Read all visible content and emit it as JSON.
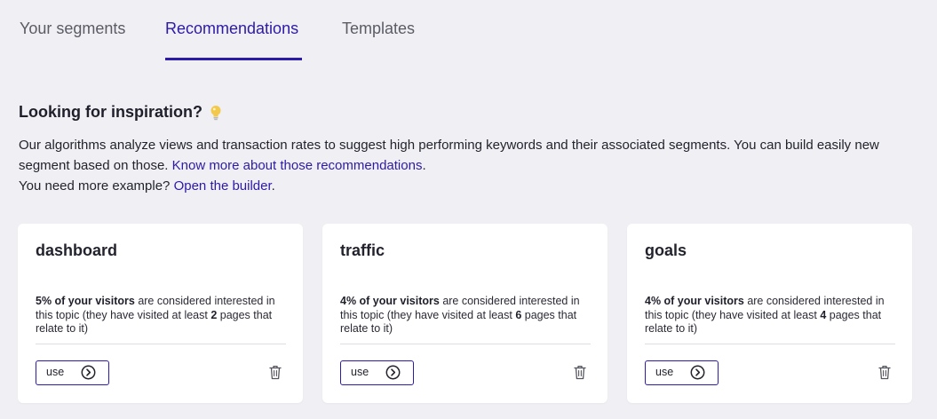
{
  "tabs": [
    {
      "label": "Your segments"
    },
    {
      "label": "Recommendations"
    },
    {
      "label": "Templates"
    }
  ],
  "intro": {
    "heading": "Looking for inspiration?",
    "line1": "Our algorithms analyze views and transaction rates to suggest high performing keywords and their associated segments. You can build easily new segment based on those. ",
    "know_more_link": "Know more about those recommendations",
    "period1": ".",
    "line2": "You need more example? ",
    "builder_link": "Open the builder",
    "period2": "."
  },
  "cards": [
    {
      "title": "dashboard",
      "percent": "5% of your visitors",
      "text_a": " are considered interested in this topic (they have visited at least ",
      "pages": "2",
      "text_b": " pages that relate to it)",
      "use_label": "use"
    },
    {
      "title": "traffic",
      "percent": "4% of your visitors",
      "text_a": " are considered interested in this topic (they have visited at least ",
      "pages": "6",
      "text_b": " pages that relate to it)",
      "use_label": "use"
    },
    {
      "title": "goals",
      "percent": "4% of your visitors",
      "text_a": " are considered interested in this topic (they have visited at least ",
      "pages": "4",
      "text_b": " pages that relate to it)",
      "use_label": "use"
    }
  ],
  "colors": {
    "accent": "#2c1aa8",
    "background": "#f0f0f4",
    "card": "#ffffff",
    "bulb": "#f2c94c"
  },
  "icons": {
    "heading": "lightbulb-icon",
    "use": "arrow-right-circle-icon",
    "delete": "trash-icon"
  }
}
